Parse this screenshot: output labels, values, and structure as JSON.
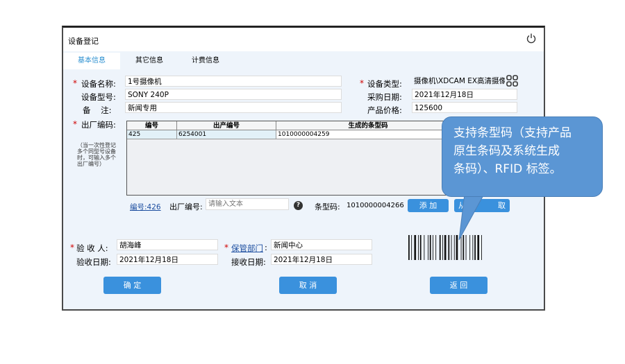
{
  "window": {
    "title": "设备登记"
  },
  "tabs": [
    {
      "label": "基本信息"
    },
    {
      "label": "其它信息"
    },
    {
      "label": "计费信息"
    }
  ],
  "form": {
    "device_name_label": "设备名称:",
    "device_name_value": "1号摄像机",
    "device_model_label": "设备型号:",
    "device_model_value": "SONY 240P",
    "remark_label": "备    注:",
    "remark_value": "新闻专用",
    "device_type_label": "设备类型:",
    "device_type_value": "摄像机\\XDCAM EX高清摄像",
    "purchase_date_label": "采购日期:",
    "purchase_date_value": "2021年12月18日",
    "price_label": "产品价格:",
    "price_value": "125600",
    "serial_label": "出厂编码:",
    "serial_note": "（当一次性登记多个同型号设备时，可输入多个出厂编号）"
  },
  "serial_grid": {
    "columns": [
      "编号",
      "出产编号",
      "生成的条型码"
    ],
    "rows": [
      [
        "425",
        "6254001",
        "1010000004259"
      ]
    ]
  },
  "entry_bar": {
    "number_link": "编号:426",
    "serial_label": "出厂编号:",
    "serial_placeholder": "请输入文本",
    "help_icon": "?",
    "barcode_label": "条型码:",
    "barcode_value": "1010000004266",
    "add_button": "添 加",
    "partial_button_left": "从",
    "partial_button_right": "取"
  },
  "acceptance": {
    "inspector_label": "验 收 人:",
    "inspector_value": "胡海峰",
    "accept_date_label": "验收日期:",
    "accept_date_value": "2021年12月18日",
    "dept_label": "保管部门",
    "dept_colon": ":",
    "dept_value": "新闻中心",
    "receive_date_label": "接收日期:",
    "receive_date_value": "2021年12月18日"
  },
  "buttons": {
    "confirm": "确 定",
    "cancel": "取 消",
    "back": "返 回"
  },
  "callout": {
    "line1": "支持条型码（支持产品",
    "line2": "原生条码及系统生成",
    "line3": "条码）、RFID 标签。"
  },
  "colors": {
    "accent": "#3a91dd",
    "callout": "#5b96d4",
    "required": "#d00000",
    "link": "#1a4c9f"
  },
  "icons": [
    "power-icon",
    "qr-icon",
    "help-icon",
    "barcode-image"
  ]
}
